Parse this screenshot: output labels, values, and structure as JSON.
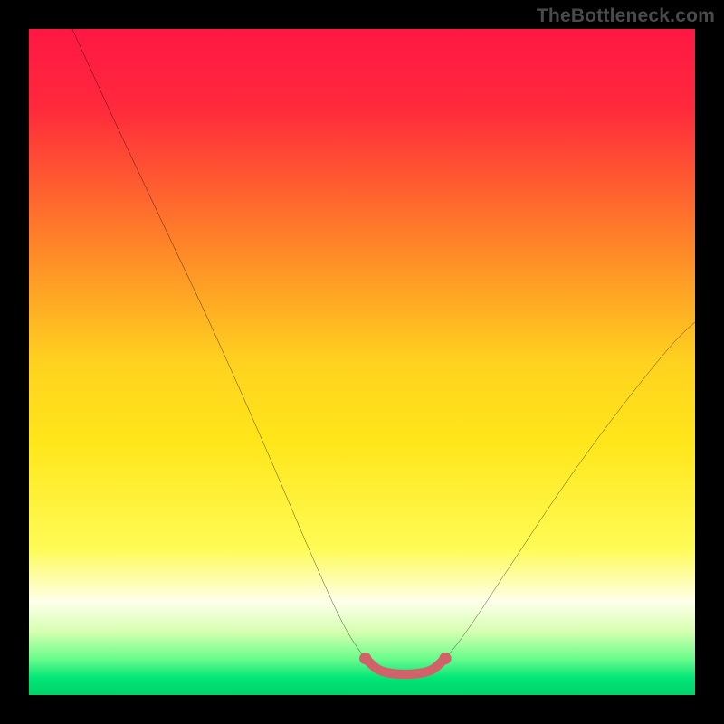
{
  "watermark": "TheBottleneck.com",
  "chart_data": {
    "type": "line",
    "title": "",
    "xlabel": "",
    "ylabel": "",
    "xlim": [
      0,
      100
    ],
    "ylim": [
      0,
      100
    ],
    "gradient": {
      "stops": [
        {
          "offset": 0.0,
          "color": "#ff1744"
        },
        {
          "offset": 0.12,
          "color": "#ff2a3c"
        },
        {
          "offset": 0.3,
          "color": "#ff7a2a"
        },
        {
          "offset": 0.5,
          "color": "#ffd21f"
        },
        {
          "offset": 0.62,
          "color": "#ffe61a"
        },
        {
          "offset": 0.78,
          "color": "#fffb55"
        },
        {
          "offset": 0.86,
          "color": "#fdffea"
        },
        {
          "offset": 0.905,
          "color": "#d6ffb0"
        },
        {
          "offset": 0.945,
          "color": "#6cfc8c"
        },
        {
          "offset": 0.975,
          "color": "#00e676"
        },
        {
          "offset": 1.0,
          "color": "#00d469"
        }
      ]
    },
    "curve_main": [
      {
        "x": 6.5,
        "y": 100
      },
      {
        "x": 12,
        "y": 88
      },
      {
        "x": 20,
        "y": 71
      },
      {
        "x": 28,
        "y": 54
      },
      {
        "x": 36,
        "y": 36
      },
      {
        "x": 42,
        "y": 22
      },
      {
        "x": 47,
        "y": 11
      },
      {
        "x": 50.5,
        "y": 5.5
      },
      {
        "x": 52.5,
        "y": 3.8
      },
      {
        "x": 55,
        "y": 3.2
      },
      {
        "x": 58,
        "y": 3.2
      },
      {
        "x": 60.5,
        "y": 3.8
      },
      {
        "x": 62.5,
        "y": 5.5
      },
      {
        "x": 66,
        "y": 10
      },
      {
        "x": 72,
        "y": 19
      },
      {
        "x": 80,
        "y": 31
      },
      {
        "x": 88,
        "y": 42
      },
      {
        "x": 96,
        "y": 52
      },
      {
        "x": 100,
        "y": 56
      }
    ],
    "curve_accent": [
      {
        "x": 50.5,
        "y": 5.5
      },
      {
        "x": 52.5,
        "y": 3.8
      },
      {
        "x": 55,
        "y": 3.2
      },
      {
        "x": 58,
        "y": 3.2
      },
      {
        "x": 60.5,
        "y": 3.8
      },
      {
        "x": 62.5,
        "y": 5.5
      }
    ],
    "accent_color": "#d1626a",
    "accent_endpoint_radius": 0.9
  }
}
